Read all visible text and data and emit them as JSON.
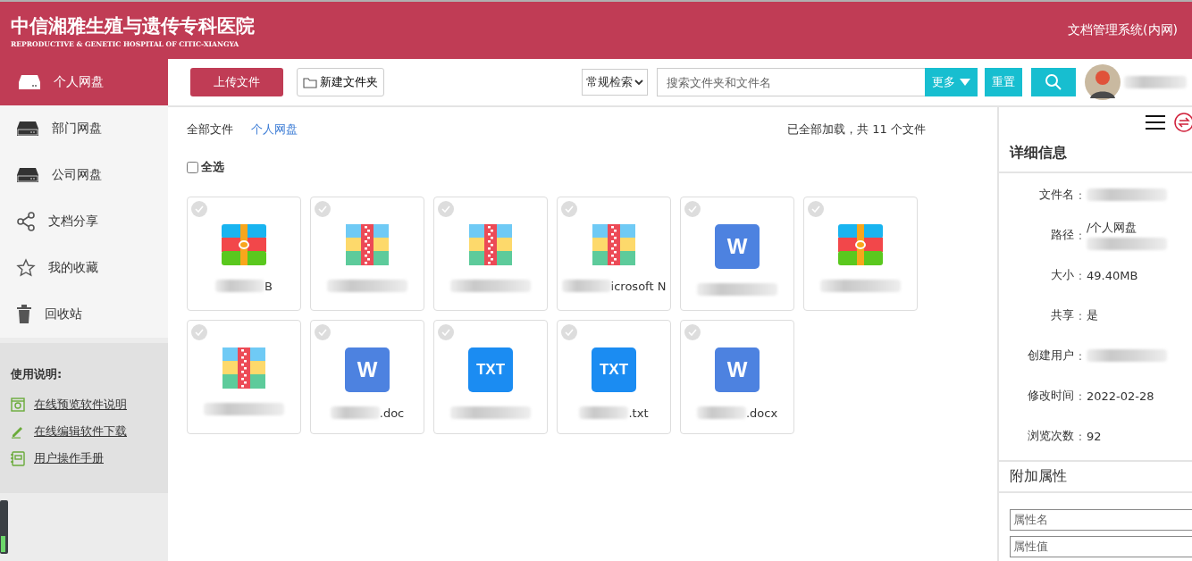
{
  "header": {
    "logo_title": "中信湘雅生殖与遗传专科医院",
    "logo_subtitle": "REPRODUCTIVE & GENETIC HOSPITAL OF CITIC-XIANGYA",
    "system_name": "文档管理系统(内网)"
  },
  "sidebar": {
    "items": [
      {
        "label": "个人网盘",
        "selected": true
      },
      {
        "label": "部门网盘",
        "selected": false
      },
      {
        "label": "公司网盘",
        "selected": false
      },
      {
        "label": "文档分享",
        "selected": false
      },
      {
        "label": "我的收藏",
        "selected": false
      },
      {
        "label": "回收站",
        "selected": false
      }
    ],
    "help_title": "使用说明:",
    "help_links": [
      {
        "label": "在线预览软件说明"
      },
      {
        "label": "在线编辑软件下载"
      },
      {
        "label": "用户操作手册"
      }
    ]
  },
  "toolbar": {
    "upload": "上传文件",
    "new_folder": "新建文件夹",
    "search_mode": "常规检索",
    "search_placeholder": "搜索文件夹和文件名",
    "more": "更多",
    "reset": "重置"
  },
  "breadcrumb": [
    {
      "label": "全部文件",
      "selected": false
    },
    {
      "label": "个人网盘",
      "selected": true
    }
  ],
  "status": "已全部加载，共 11 个文件",
  "select_all": {
    "label": "全选",
    "checked": false
  },
  "files": [
    {
      "kind": "archive",
      "name": "B",
      "checked": false
    },
    {
      "kind": "zip",
      "checked": false
    },
    {
      "kind": "zip",
      "checked": false
    },
    {
      "kind": "zip",
      "name": "icrosoft N",
      "checked": false
    },
    {
      "kind": "word",
      "badge": "W",
      "checked": false
    },
    {
      "kind": "archive",
      "checked": false
    },
    {
      "kind": "zip",
      "checked": false
    },
    {
      "kind": "word",
      "badge": "W",
      "name": ".doc",
      "checked": false
    },
    {
      "kind": "txt",
      "badge": "TXT",
      "checked": false
    },
    {
      "kind": "txt",
      "badge": "TXT",
      "name": ".txt",
      "checked": false
    },
    {
      "kind": "word",
      "badge": "W",
      "name": ".docx",
      "checked": false
    }
  ],
  "details": {
    "title": "详细信息",
    "fields": [
      {
        "label": "文件名",
        "colon": ":",
        "redacted": true
      },
      {
        "label": "路径",
        "colon": ":",
        "value": "/个人网盘",
        "redacted": true
      },
      {
        "label": "大小",
        "colon": ":",
        "value": "49.40MB"
      },
      {
        "label": "共享",
        "colon": ":",
        "value": "是"
      },
      {
        "label": "创建用户",
        "colon": ":",
        "redacted": true
      },
      {
        "label": "修改时间",
        "colon": ":",
        "value": "2022-02-28"
      },
      {
        "label": "浏览次数",
        "colon": ":",
        "value": "92"
      }
    ],
    "extra_title": "附加属性",
    "attr_name_placeholder": "属性名",
    "attr_value_placeholder": "属性值"
  }
}
